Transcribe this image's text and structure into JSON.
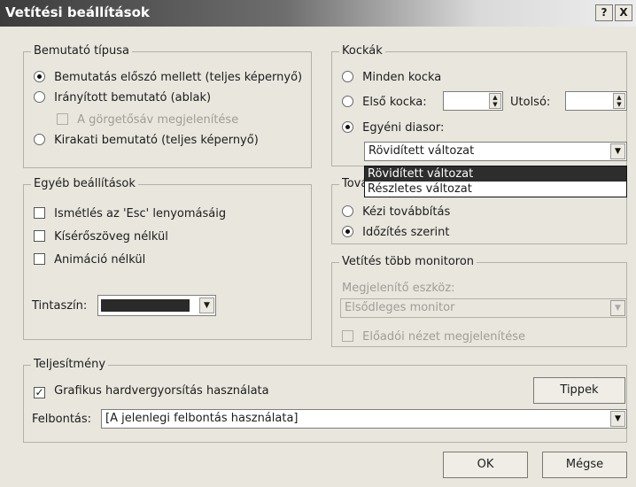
{
  "window": {
    "title": "Vetítési beállítások",
    "help_button": "?",
    "close_button": "X"
  },
  "show_type": {
    "legend": "Bemutató típusa",
    "options": [
      {
        "label": "Bemutatás előszó mellett (teljes képernyő)",
        "selected": true
      },
      {
        "label": "Irányított bemutató (ablak)",
        "selected": false
      },
      {
        "label": "Kirakati bemutató (teljes képernyő)",
        "selected": false
      }
    ],
    "scrollbar_check": {
      "label": "A görgetősáv megjelenítése",
      "checked": false,
      "disabled": true
    }
  },
  "slides": {
    "legend": "Kockák",
    "all_label": "Minden kocka",
    "from_label": "Első kocka:",
    "to_label": "Utolsó:",
    "custom_label": "Egyéni diasor:",
    "custom_value": "Rövidített változat",
    "dropdown_options": [
      "Rövidített változat",
      "Részletes változat"
    ]
  },
  "other": {
    "legend": "Egyéb beállítások",
    "checks": [
      {
        "label": "Ismétlés az 'Esc' lenyomásáig",
        "checked": false
      },
      {
        "label": "Kísérőszöveg nélkül",
        "checked": false
      },
      {
        "label": "Animáció nélkül",
        "checked": false
      }
    ],
    "pen_color_label": "Tintaszín:",
    "pen_color": "#2a2a2a"
  },
  "advance": {
    "legend": "Továbbítás",
    "manual_label": "Kézi továbbítás",
    "timing_label": "Időzítés szerint"
  },
  "monitors": {
    "legend": "Vetítés több monitoron",
    "display_label": "Megjelenítő eszköz:",
    "display_value": "Elsődleges monitor",
    "presenter_view_label": "Előadói nézet megjelenítése"
  },
  "performance": {
    "legend": "Teljesítmény",
    "hw_accel_label": "Grafikus hardvergyorsítás használata",
    "tips_button": "Tippek",
    "resolution_label": "Felbontás:",
    "resolution_value": "[A jelenlegi felbontás használata]"
  },
  "buttons": {
    "ok": "OK",
    "cancel": "Mégse"
  }
}
